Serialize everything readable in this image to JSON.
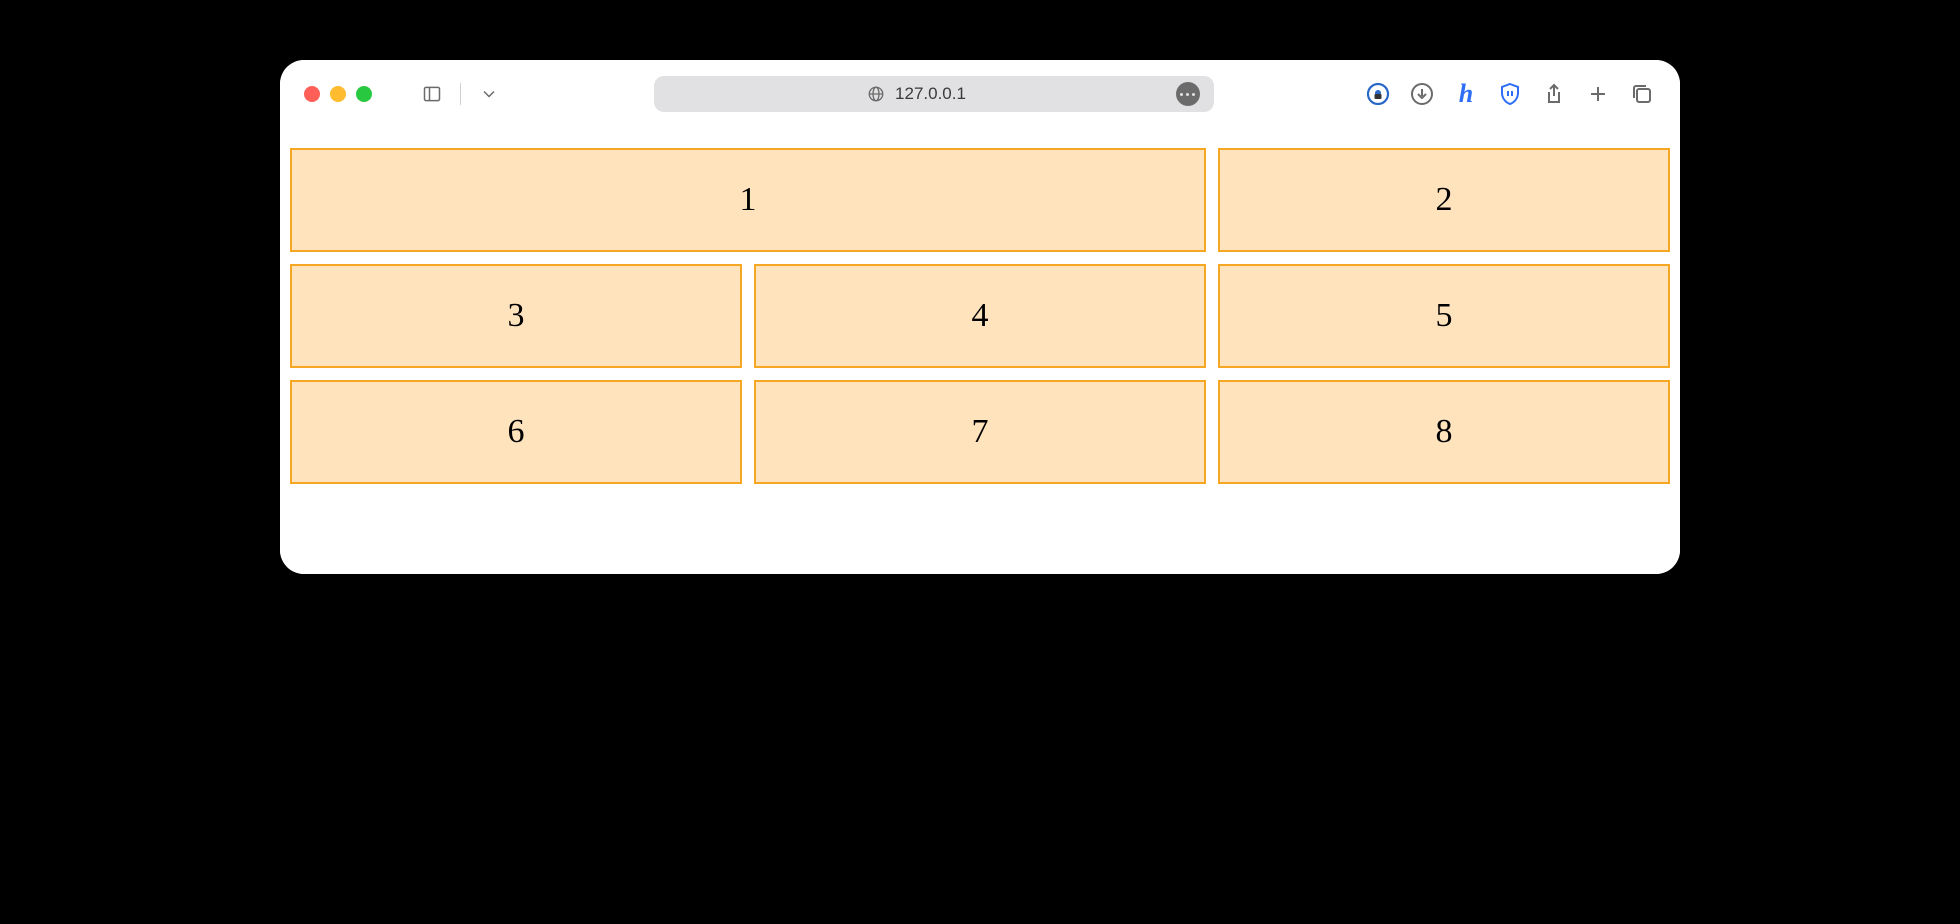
{
  "browser": {
    "address": "127.0.0.1"
  },
  "grid": {
    "cells": [
      {
        "label": "1",
        "span": 2
      },
      {
        "label": "2",
        "span": 1
      },
      {
        "label": "3",
        "span": 1
      },
      {
        "label": "4",
        "span": 1
      },
      {
        "label": "5",
        "span": 1
      },
      {
        "label": "6",
        "span": 1
      },
      {
        "label": "7",
        "span": 1
      },
      {
        "label": "8",
        "span": 1
      }
    ]
  }
}
